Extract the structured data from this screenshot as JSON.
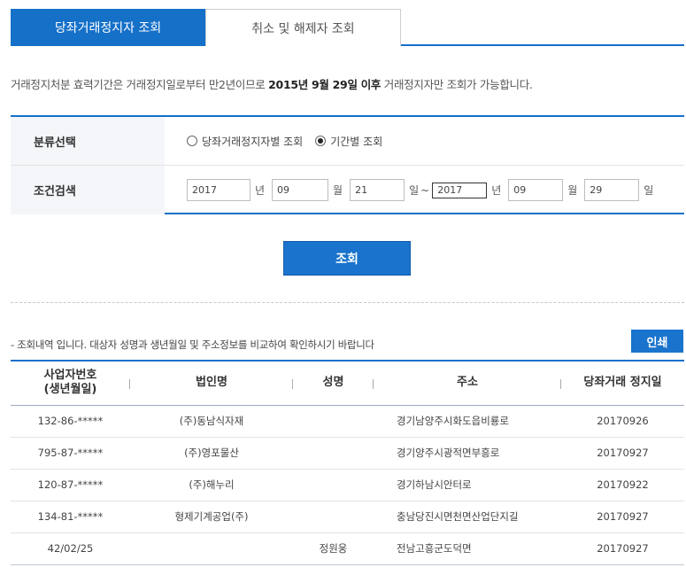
{
  "tabs": [
    {
      "label": "당좌거래정지자 조회",
      "active": true
    },
    {
      "label": "취소 및 해제자 조회",
      "active": false
    }
  ],
  "notice": {
    "prefix": "거래정지처분 효력기간은 거래정지일로부터 만2년이므로 ",
    "bold": "2015년 9월 29일 이후",
    "suffix": " 거래정지자만 조회가 가능합니다."
  },
  "form": {
    "category_label": "분류선택",
    "radio_options": [
      {
        "label": "당좌거래정지자별 조회",
        "checked": false
      },
      {
        "label": "기간별 조회",
        "checked": true
      }
    ],
    "condition_label": "조건검색",
    "from": {
      "year": "2017",
      "month": "09",
      "day": "21"
    },
    "to": {
      "year": "2017",
      "month": "09",
      "day": "29"
    },
    "unit_year": "년",
    "unit_month": "월",
    "unit_day": "일",
    "range_separator": "~"
  },
  "search_button": "조회",
  "result_info": "- 조회내역 입니다. 대상자 성명과 생년월일 및 주소정보를 비교하여 확인하시기 바랍니다",
  "print_button": "인쇄",
  "table": {
    "headers": {
      "biz_no_line1": "사업자번호",
      "biz_no_line2": "(생년월일)",
      "company": "법인명",
      "name": "성명",
      "address": "주소",
      "date": "당좌거래 정지일"
    },
    "rows": [
      {
        "biz_no": "132-86-*****",
        "company": "(주)동남식자재",
        "name": "",
        "address": "경기남양주시화도읍비룡로",
        "date": "20170926"
      },
      {
        "biz_no": "795-87-*****",
        "company": "(주)영포물산",
        "name": "",
        "address": "경기양주시광적면부흥로",
        "date": "20170927"
      },
      {
        "biz_no": "120-87-*****",
        "company": "(주)해누리",
        "name": "",
        "address": "경기하남시안터로",
        "date": "20170922"
      },
      {
        "biz_no": "134-81-*****",
        "company": "형제기계공업(주)",
        "name": "",
        "address": "충남당진시면천면산업단지길",
        "date": "20170927"
      },
      {
        "biz_no": "42/02/25",
        "company": "",
        "name": "정원웅",
        "address": "전남고흥군도덕면",
        "date": "20170927"
      }
    ]
  },
  "colors": {
    "accent": "#1570c8",
    "button": "#1a73cc",
    "label_bg": "#f4f6f9"
  }
}
